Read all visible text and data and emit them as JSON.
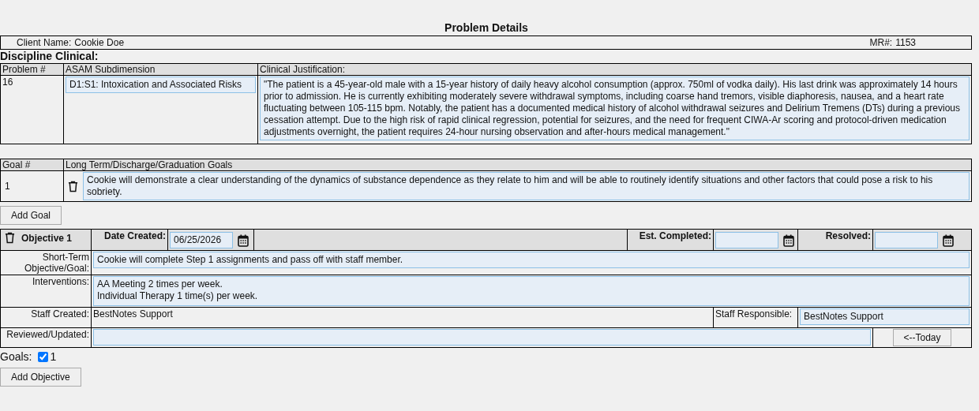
{
  "title": "Problem Details",
  "client": {
    "name_label": "Client Name:",
    "name": "Cookie Doe",
    "mr_label": "MR#:",
    "mr": "1153"
  },
  "discipline": "Discipline Clinical:",
  "problem_table": {
    "columns": [
      "Problem #",
      "ASAM Subdimension",
      "Clinical Justification:"
    ],
    "rows": [
      {
        "number": "16",
        "subdimension": "D1:S1: Intoxication and Associated Risks",
        "justification": "\"The patient is a 45-year-old male with a 15-year history of daily heavy alcohol consumption (approx. 750ml of vodka daily). His last drink was approximately 14 hours prior to admission. He is currently exhibiting moderately severe withdrawal symptoms, including coarse hand tremors, visible diaphoresis, nausea, and a heart rate fluctuating between 105-115 bpm. Notably, the patient has a documented medical history of alcohol withdrawal seizures and Delirium Tremens (DTs) during a previous cessation attempt. Due to the high risk of rapid clinical regression, potential for seizures, and the need for frequent CIWA-Ar scoring and protocol-driven medication adjustments overnight, the patient requires 24-hour nursing observation and after-hours medical management.\""
      }
    ]
  },
  "goal_table": {
    "columns": [
      "Goal #",
      "Long Term/Discharge/Graduation Goals"
    ],
    "rows": [
      {
        "number": "1",
        "goal": "Cookie will demonstrate a clear understanding of the dynamics of substance dependence as they relate to him and will be able to routinely identify situations and other factors that could pose a risk to his sobriety."
      }
    ]
  },
  "add_goal_button": "Add Goal",
  "objective": {
    "title": "Objective 1",
    "date_created_label": "Date Created:",
    "date_created": "06/25/2026",
    "est_completed_label": "Est. Completed:",
    "resolved_label": "Resolved:",
    "short_term_label": "Short-Term Objective/Goal:",
    "short_term": "Cookie will complete Step 1 assignments and pass off with staff member.",
    "interventions_label": "Interventions:",
    "interventions": [
      "AA Meeting 2 times per week.",
      "Individual Therapy 1 time(s) per week."
    ],
    "staff_created_label": "Staff Created:",
    "staff_created": "BestNotes Support",
    "staff_responsible_label": "Staff Responsible:",
    "staff_responsible": "BestNotes Support",
    "reviewed_label": "Reviewed/Updated:",
    "today_button": "<--Today"
  },
  "goals": {
    "label": "Goals:",
    "items": [
      {
        "label": "1",
        "checked": true
      }
    ]
  },
  "add_objective_button": "Add Objective"
}
